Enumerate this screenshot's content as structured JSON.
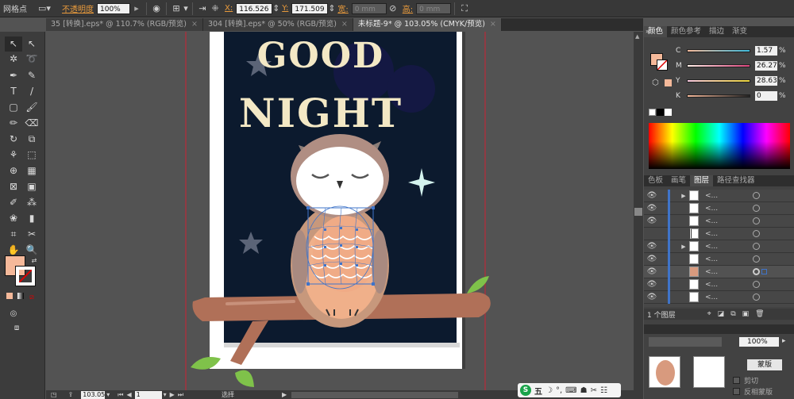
{
  "control_bar": {
    "selection_label": "网格点",
    "opacity_label": "不透明度",
    "opacity_value": "100%",
    "x_label": "X:",
    "x_value": "116.526",
    "y_label": "Y:",
    "y_value": "171.509",
    "width_label": "宽:",
    "width_value": "0 mm",
    "height_label": "高:",
    "height_value": "0 mm"
  },
  "tabs": [
    {
      "label": "35 [转换].eps* @ 110.7% (RGB/预览)",
      "active": false
    },
    {
      "label": "304 [转换].eps* @ 50% (RGB/预览)",
      "active": false
    },
    {
      "label": "未标题-9* @ 103.05% (CMYK/预览)",
      "active": true
    }
  ],
  "artwork": {
    "line1": "GOOD",
    "line2": "NIGHT"
  },
  "color_panel": {
    "tabs": [
      "颜色",
      "颜色参考",
      "描边",
      "渐变"
    ],
    "channels": [
      {
        "name": "C",
        "value": "1.57",
        "gradient": "#3fb8d8"
      },
      {
        "name": "M",
        "value": "26.27",
        "gradient": "#d8427a"
      },
      {
        "name": "Y",
        "value": "28.63",
        "gradient": "#e8d23a"
      },
      {
        "name": "K",
        "value": "0",
        "gradient": "#222222"
      }
    ],
    "fill_color": "#f5b99a"
  },
  "layers_panel": {
    "tabs": [
      "色板",
      "画笔",
      "图层",
      "路径查找器"
    ],
    "rows": [
      {
        "name": "<...",
        "expand": true
      },
      {
        "name": "<...",
        "expand": false
      },
      {
        "name": "<...",
        "expand": false
      },
      {
        "name": "<...",
        "expand": false
      },
      {
        "name": "<...",
        "expand": true
      },
      {
        "name": "<...",
        "expand": false
      },
      {
        "name": "<...",
        "expand": false
      },
      {
        "name": "<...",
        "expand": false
      },
      {
        "name": "<...",
        "expand": false
      }
    ],
    "footer": "1 个图层"
  },
  "transparency_panel": {
    "opacity_value": "100%",
    "mask_button": "蒙版",
    "clip_label": "剪切",
    "invert_label": "反相蒙版"
  },
  "status_bar": {
    "zoom": "103.05",
    "page": "1",
    "mode": "选择"
  },
  "ime": {
    "label": "五"
  },
  "accent_colors": {
    "selection_blue": "#3f74c9",
    "night_navy": "#0c1a2e",
    "text_cream": "#f3e8c5",
    "branch_brown": "#b07058"
  }
}
